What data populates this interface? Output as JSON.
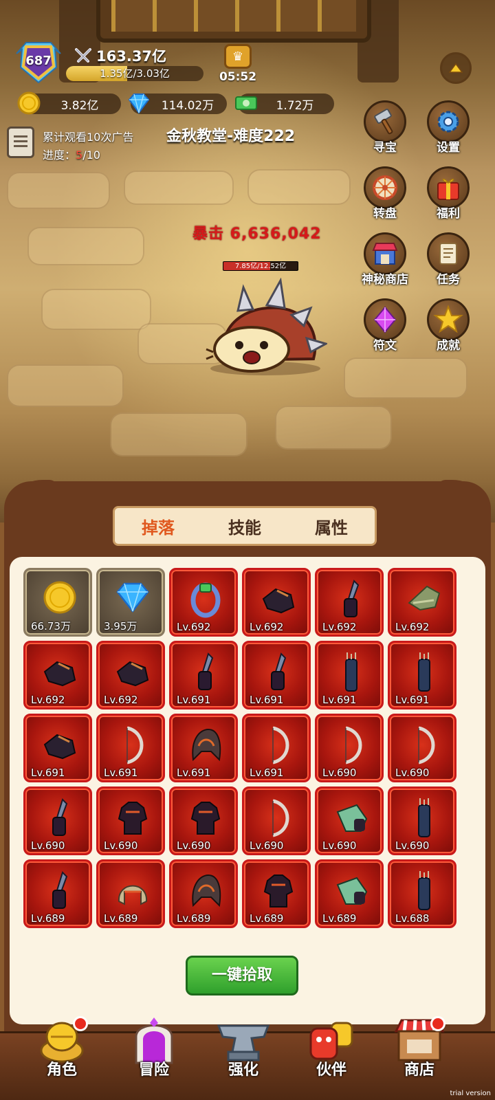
{
  "header": {
    "player_level": "687",
    "combat_power": "163.37亿",
    "exp_text": "1.35亿/3.03亿",
    "exp_progress": 0.4455,
    "timer": "05:52"
  },
  "currencies": {
    "gold": "3.82亿",
    "diamond": "114.02万",
    "cash": "1.72万"
  },
  "quest": {
    "title": "累计观看10次广告",
    "progress_label": "进度：",
    "progress_current": "5",
    "progress_total": "/10"
  },
  "stage": {
    "name": "金秋教堂-难度222"
  },
  "side_menu": [
    {
      "label": "寻宝",
      "icon": "hammer-icon"
    },
    {
      "label": "设置",
      "icon": "gear-icon"
    },
    {
      "label": "转盘",
      "icon": "wheel-icon"
    },
    {
      "label": "福利",
      "icon": "gift-icon"
    },
    {
      "label": "神秘商店",
      "icon": "shop-icon"
    },
    {
      "label": "任务",
      "icon": "scroll-icon"
    },
    {
      "label": "符文",
      "icon": "rune-crystal-icon"
    },
    {
      "label": "成就",
      "icon": "star-icon"
    }
  ],
  "battle": {
    "crit_text": "暴击 6,636,042",
    "boss_hp_text": "7.85亿/12.52亿",
    "boss_hp_fraction": 0.627
  },
  "panel": {
    "tabs": [
      "掉落",
      "技能",
      "属性"
    ],
    "active_tab": 0,
    "pickup_button": "一键拾取"
  },
  "loot": [
    {
      "label": "66.73万",
      "kind": "gold-coin",
      "res": true
    },
    {
      "label": "3.95万",
      "kind": "diamond",
      "res": true
    },
    {
      "label": "Lv.692",
      "kind": "ring"
    },
    {
      "label": "Lv.692",
      "kind": "gauntlet"
    },
    {
      "label": "Lv.692",
      "kind": "dagger"
    },
    {
      "label": "Lv.692",
      "kind": "hat"
    },
    {
      "label": "Lv.692",
      "kind": "gauntlet"
    },
    {
      "label": "Lv.692",
      "kind": "gauntlet"
    },
    {
      "label": "Lv.691",
      "kind": "dagger"
    },
    {
      "label": "Lv.691",
      "kind": "dagger"
    },
    {
      "label": "Lv.691",
      "kind": "quiver"
    },
    {
      "label": "Lv.691",
      "kind": "quiver"
    },
    {
      "label": "Lv.691",
      "kind": "gauntlet"
    },
    {
      "label": "Lv.691",
      "kind": "bow"
    },
    {
      "label": "Lv.691",
      "kind": "hood"
    },
    {
      "label": "Lv.691",
      "kind": "bow"
    },
    {
      "label": "Lv.690",
      "kind": "bow"
    },
    {
      "label": "Lv.690",
      "kind": "bow"
    },
    {
      "label": "Lv.690",
      "kind": "dagger"
    },
    {
      "label": "Lv.690",
      "kind": "armor"
    },
    {
      "label": "Lv.690",
      "kind": "armor"
    },
    {
      "label": "Lv.690",
      "kind": "bow"
    },
    {
      "label": "Lv.690",
      "kind": "glove"
    },
    {
      "label": "Lv.690",
      "kind": "quiver"
    },
    {
      "label": "Lv.689",
      "kind": "dagger"
    },
    {
      "label": "Lv.689",
      "kind": "helmet"
    },
    {
      "label": "Lv.689",
      "kind": "hood"
    },
    {
      "label": "Lv.689",
      "kind": "armor"
    },
    {
      "label": "Lv.689",
      "kind": "glove"
    },
    {
      "label": "Lv.688",
      "kind": "quiver"
    }
  ],
  "bottom_nav": [
    {
      "label": "角色",
      "icon": "character-icon",
      "badge": true
    },
    {
      "label": "冒险",
      "icon": "portal-icon",
      "badge": false
    },
    {
      "label": "强化",
      "icon": "anvil-icon",
      "badge": false
    },
    {
      "label": "伙伴",
      "icon": "companion-icon",
      "badge": false
    },
    {
      "label": "商店",
      "icon": "store-icon",
      "badge": true
    }
  ],
  "watermark": "trial version",
  "colors": {
    "accent_tab": "#e0581e",
    "item_red": "#c8191a",
    "pickup_green": "#2fa02c",
    "crit_red": "#d61a1a"
  }
}
